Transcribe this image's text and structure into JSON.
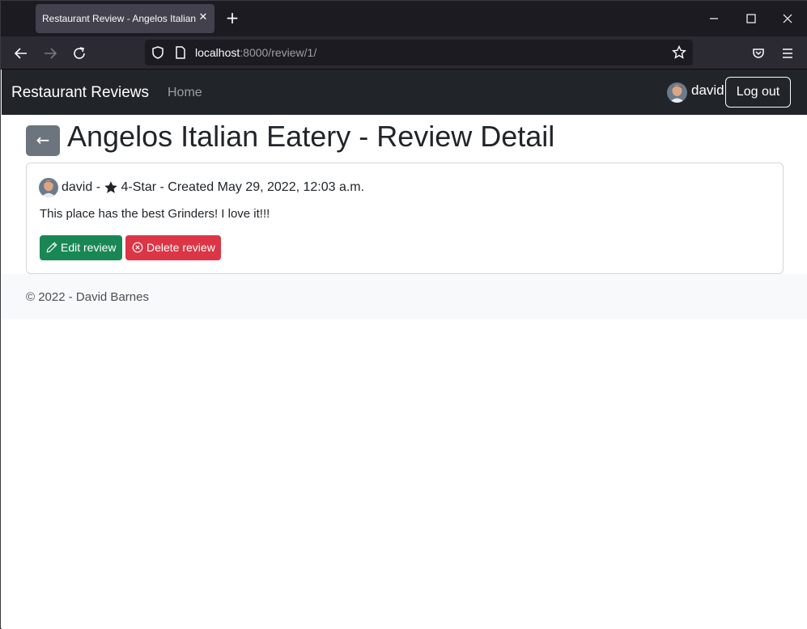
{
  "browser": {
    "tab_title": "Restaurant Review - Angelos Italian Eatery",
    "tab_close_glyph": "✕",
    "new_tab_glyph": "+",
    "url_host": "localhost",
    "url_rest": ":8000/review/1/",
    "icons": [
      "back-icon",
      "forward-icon",
      "reload-icon",
      "shield-icon",
      "page-icon",
      "bookmark-star-icon",
      "pocket-icon",
      "menu-icon",
      "minimize-icon",
      "maximize-icon",
      "close-icon"
    ]
  },
  "site": {
    "brand": "Restaurant Reviews",
    "nav_home": "Home",
    "user_name": "david",
    "logout_label": "Log out"
  },
  "main": {
    "back_glyph": "←",
    "title": "Angelos Italian Eatery - Review Detail",
    "review": {
      "author": "david",
      "separator1": " - ",
      "rating": "4-Star",
      "created": " - Created May 29, 2022, 12:03 a.m.",
      "text": "This place has the best Grinders! I love it!!!",
      "edit_label": "Edit review",
      "delete_label": "Delete review"
    }
  },
  "footer": {
    "text": "© 2022 - David Barnes"
  },
  "colors": {
    "navbar": "#212529",
    "edit": "#198754",
    "delete": "#dc3545",
    "back": "#6c757d"
  }
}
